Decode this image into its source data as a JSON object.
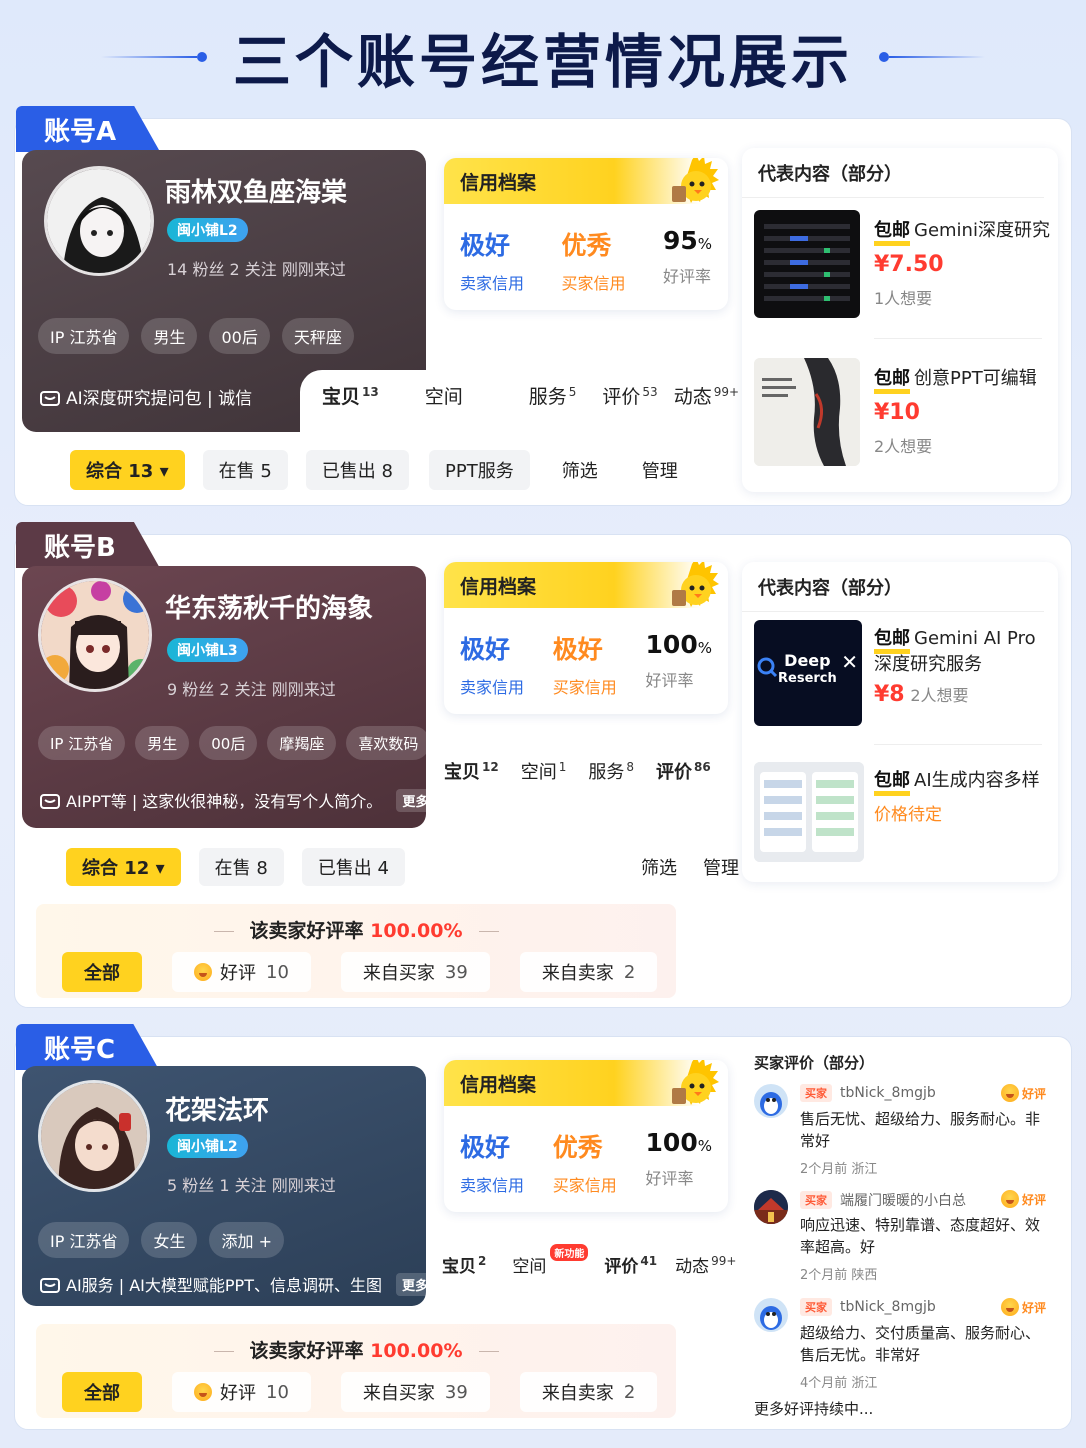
{
  "title": "三个账号经营情况展示",
  "accounts": [
    {
      "tab": "账号A",
      "name": "雨林双鱼座海棠",
      "level": "闽小铺L2",
      "stats": "14 粉丝   2 关注   刚刚来过",
      "chips": [
        "IP 江苏省",
        "男生",
        "00后",
        "天秤座"
      ],
      "intro": "AI深度研究提问包 | 诚信",
      "credit": {
        "title": "信用档案",
        "seller_value": "极好",
        "seller_label": "卖家信用",
        "buyer_value": "优秀",
        "buyer_label": "买家信用",
        "rate": "95",
        "rate_unit": "%",
        "rate_label": "好评率"
      },
      "tabs": [
        {
          "label": "宝贝",
          "count": "13"
        },
        {
          "label": "空间",
          "count": ""
        },
        {
          "label": "服务",
          "count": "5"
        },
        {
          "label": "评价",
          "count": "53"
        },
        {
          "label": "动态",
          "count": "99+"
        }
      ],
      "filters": [
        "综合 13 ▾",
        "在售 5",
        "已售出 8",
        "PPT服务",
        "筛选",
        "管理"
      ],
      "panel_title": "代表内容（部分）",
      "items": [
        {
          "tag": "包邮",
          "title": "Gemini深度研究",
          "price": "¥7.50",
          "want": "1人想要"
        },
        {
          "tag": "包邮",
          "title": "创意PPT可编辑",
          "price": "¥10",
          "want": "2人想要"
        }
      ]
    },
    {
      "tab": "账号B",
      "name": "华东荡秋千的海象",
      "level": "闽小铺L3",
      "stats": "9 粉丝   2 关注   刚刚来过",
      "chips": [
        "IP 江苏省",
        "男生",
        "00后",
        "摩羯座",
        "喜欢数码"
      ],
      "intro": "AIPPT等 | 这家伙很神秘，没有写个人简介。",
      "more": "更多▸",
      "credit": {
        "title": "信用档案",
        "seller_value": "极好",
        "seller_label": "卖家信用",
        "buyer_value": "极好",
        "buyer_label": "买家信用",
        "rate": "100",
        "rate_unit": "%",
        "rate_label": "好评率"
      },
      "tabs": [
        {
          "label": "宝贝",
          "count": "12"
        },
        {
          "label": "空间",
          "count": "1"
        },
        {
          "label": "服务",
          "count": "8"
        },
        {
          "label": "评价",
          "count": "86"
        }
      ],
      "filters": [
        "综合 12 ▾",
        "在售 8",
        "已售出 4",
        "筛选",
        "管理"
      ],
      "reputation": {
        "prefix": "该卖家好评率",
        "value": "100.00%",
        "buttons": [
          "全部",
          "好评",
          "来自买家",
          "来自卖家"
        ],
        "counts": [
          "",
          "10",
          "39",
          "2"
        ]
      },
      "panel_title": "代表内容（部分）",
      "items": [
        {
          "tag": "包邮",
          "title": "Gemini AI Pro 深度研究服务",
          "price": "¥8",
          "want": "2人想要",
          "thumb_text1": "Deep",
          "thumb_text2": "Reserch"
        },
        {
          "tag": "包邮",
          "title": "AI生成内容多样",
          "price": "价格待定",
          "want": ""
        }
      ]
    },
    {
      "tab": "账号C",
      "name": "花架法环",
      "level": "闽小铺L2",
      "stats": "5 粉丝   1 关注   刚刚来过",
      "chips": [
        "IP 江苏省",
        "女生",
        "添加 +"
      ],
      "intro": "AI服务 | AI大模型赋能PPT、信息调研、生图",
      "more": "更多▸",
      "credit": {
        "title": "信用档案",
        "seller_value": "极好",
        "seller_label": "卖家信用",
        "buyer_value": "优秀",
        "buyer_label": "买家信用",
        "rate": "100",
        "rate_unit": "%",
        "rate_label": "好评率"
      },
      "tabs": [
        {
          "label": "宝贝",
          "count": "2"
        },
        {
          "label": "空间",
          "count": "",
          "badge": "新功能"
        },
        {
          "label": "评价",
          "count": "41"
        },
        {
          "label": "动态",
          "count": "99+"
        }
      ],
      "reputation": {
        "prefix": "该卖家好评率",
        "value": "100.00%",
        "buttons": [
          "全部",
          "好评",
          "来自买家",
          "来自卖家"
        ],
        "counts": [
          "",
          "10",
          "39",
          "2"
        ]
      },
      "panel_title": "买家评价（部分）",
      "reviews": [
        {
          "role": "买家",
          "user": "tbNick_8mgjb",
          "rating": "好评",
          "text": "售后无忧、超级给力、服务耐心。非常好",
          "meta": "2个月前   浙江"
        },
        {
          "role": "买家",
          "user": "端履门暖暖的小白总",
          "rating": "好评",
          "text": "响应迅速、特别靠谱、态度超好、效率超高。好",
          "meta": "2个月前   陕西"
        },
        {
          "role": "买家",
          "user": "tbNick_8mgjb",
          "rating": "好评",
          "text": "超级给力、交付质量高、服务耐心、售后无忧。非常好",
          "meta": "4个月前   浙江"
        }
      ],
      "reviews_more": "更多好评持续中..."
    }
  ],
  "colors": {
    "accent_blue": "#2a5ee6",
    "yellow": "#ffd21f",
    "red_price": "#ff3b30",
    "orange": "#ff8a1f"
  }
}
